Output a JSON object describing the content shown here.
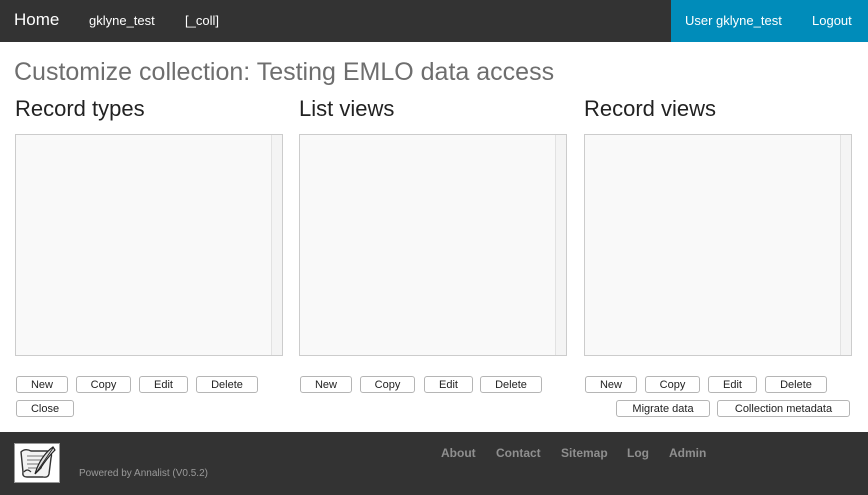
{
  "nav": {
    "home": "Home",
    "collection": "gklyne_test",
    "bracket_coll": "[_coll]",
    "user": "User gklyne_test",
    "logout": "Logout"
  },
  "page": {
    "title": "Customize collection: Testing EMLO data access"
  },
  "record_types": {
    "heading": "Record types",
    "buttons": {
      "new": "New",
      "copy": "Copy",
      "edit": "Edit",
      "delete": "Delete",
      "close": "Close"
    }
  },
  "list_views": {
    "heading": "List views",
    "buttons": {
      "new": "New",
      "copy": "Copy",
      "edit": "Edit",
      "delete": "Delete"
    }
  },
  "record_views": {
    "heading": "Record views",
    "buttons": {
      "new": "New",
      "copy": "Copy",
      "edit": "Edit",
      "delete": "Delete",
      "migrate": "Migrate data",
      "metadata": "Collection metadata"
    }
  },
  "footer": {
    "powered_by": "Powered by Annalist (V0.5.2)",
    "links": {
      "about": "About",
      "contact": "Contact",
      "sitemap": "Sitemap",
      "log": "Log",
      "admin": "Admin"
    },
    "logo_icon": "annalist-scroll-quill-icon"
  },
  "colors": {
    "topbar": "#333333",
    "user_box": "#008cba",
    "footer": "#333333"
  }
}
